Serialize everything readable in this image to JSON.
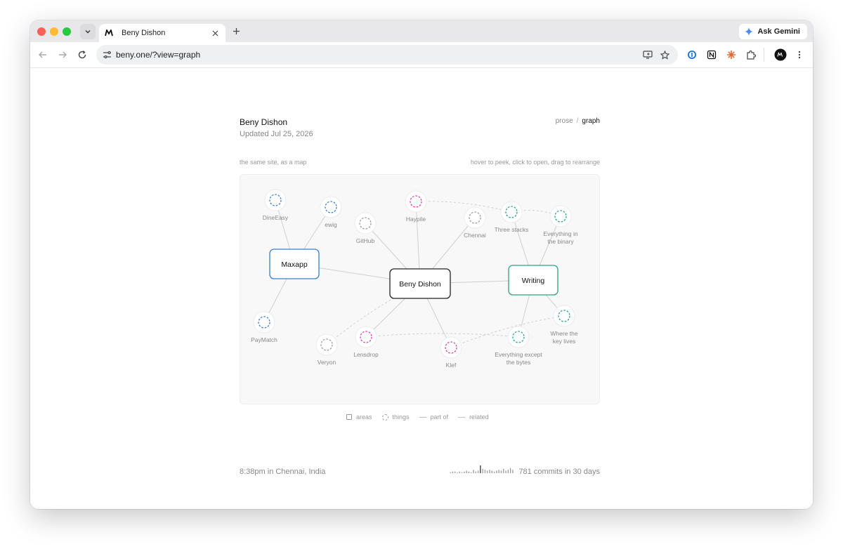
{
  "browser": {
    "tab": {
      "title": "Beny Dishon"
    },
    "url": "beny.one/?view=graph",
    "ask_gemini": "Ask Gemini"
  },
  "header": {
    "title": "Beny Dishon",
    "updated": "Updated Jul 25, 2026",
    "views": {
      "prose": "prose",
      "separator": "/",
      "graph": "graph"
    }
  },
  "captions": {
    "left": "the same site, as a map",
    "right": "hover to peek, click to open, drag to rearrange"
  },
  "graph": {
    "colors": {
      "maxapp": "#3b7fc9",
      "writing": "#2aa57a",
      "center": "#222222",
      "pink": "#d63dbb",
      "gray": "#9a9a9a"
    },
    "areas": [
      {
        "id": "center",
        "label": "Beny Dishon",
        "color": "#222222"
      },
      {
        "id": "maxapp",
        "label": "Maxapp",
        "color": "#3b7fc9"
      },
      {
        "id": "writing",
        "label": "Writing",
        "color": "#2aa57a"
      }
    ],
    "things": [
      {
        "id": "dineeasy",
        "label": [
          "DineEasy"
        ],
        "color": "#3b7fc9"
      },
      {
        "id": "ewig",
        "label": [
          "ewig"
        ],
        "color": "#3b7fc9"
      },
      {
        "id": "paymatch",
        "label": [
          "PayMatch"
        ],
        "color": "#3b7fc9"
      },
      {
        "id": "github",
        "label": [
          "GitHub"
        ],
        "color": "#9a9a9a"
      },
      {
        "id": "haypile",
        "label": [
          "Haypile"
        ],
        "color": "#d63dbb"
      },
      {
        "id": "chennai",
        "label": [
          "Chennai"
        ],
        "color": "#9a9a9a"
      },
      {
        "id": "threestacks",
        "label": [
          "Three stacks"
        ],
        "color": "#2aa57a"
      },
      {
        "id": "binary",
        "label": [
          "Everything in",
          "the binary"
        ],
        "color": "#2aa57a"
      },
      {
        "id": "keylives",
        "label": [
          "Where the",
          "key lives"
        ],
        "color": "#2aa57a"
      },
      {
        "id": "bytes",
        "label": [
          "Everything except",
          "the bytes"
        ],
        "color": "#2aa57a"
      },
      {
        "id": "klef",
        "label": [
          "Klef"
        ],
        "color": "#d63dbb"
      },
      {
        "id": "lensdrop",
        "label": [
          "Lensdrop"
        ],
        "color": "#d63dbb"
      },
      {
        "id": "veryon",
        "label": [
          "Veryon"
        ],
        "color": "#9a9a9a"
      }
    ],
    "part_of": [
      [
        "maxapp",
        "dineeasy"
      ],
      [
        "maxapp",
        "ewig"
      ],
      [
        "maxapp",
        "paymatch"
      ],
      [
        "center",
        "maxapp"
      ],
      [
        "center",
        "writing"
      ],
      [
        "center",
        "github"
      ],
      [
        "center",
        "haypile"
      ],
      [
        "center",
        "chennai"
      ],
      [
        "center",
        "lensdrop"
      ],
      [
        "center",
        "klef"
      ],
      [
        "writing",
        "threestacks"
      ],
      [
        "writing",
        "binary"
      ],
      [
        "writing",
        "keylives"
      ],
      [
        "writing",
        "bytes"
      ]
    ],
    "related": [
      [
        "haypile",
        "threestacks"
      ],
      [
        "threestacks",
        "binary"
      ],
      [
        "center",
        "veryon"
      ],
      [
        "lensdrop",
        "bytes"
      ],
      [
        "klef",
        "keylives"
      ]
    ]
  },
  "legend": {
    "areas": "areas",
    "things": "things",
    "part_of": "part of",
    "related": "related"
  },
  "footer": {
    "time": "8:38pm in Chennai, India",
    "commits": "781 commits in 30 days",
    "commit_activity": [
      1,
      2,
      2,
      1,
      2,
      1,
      2,
      3,
      2,
      1,
      4,
      2,
      3,
      9,
      5,
      4,
      3,
      4,
      3,
      2,
      3,
      4,
      3,
      5,
      3,
      4,
      6,
      4
    ]
  }
}
